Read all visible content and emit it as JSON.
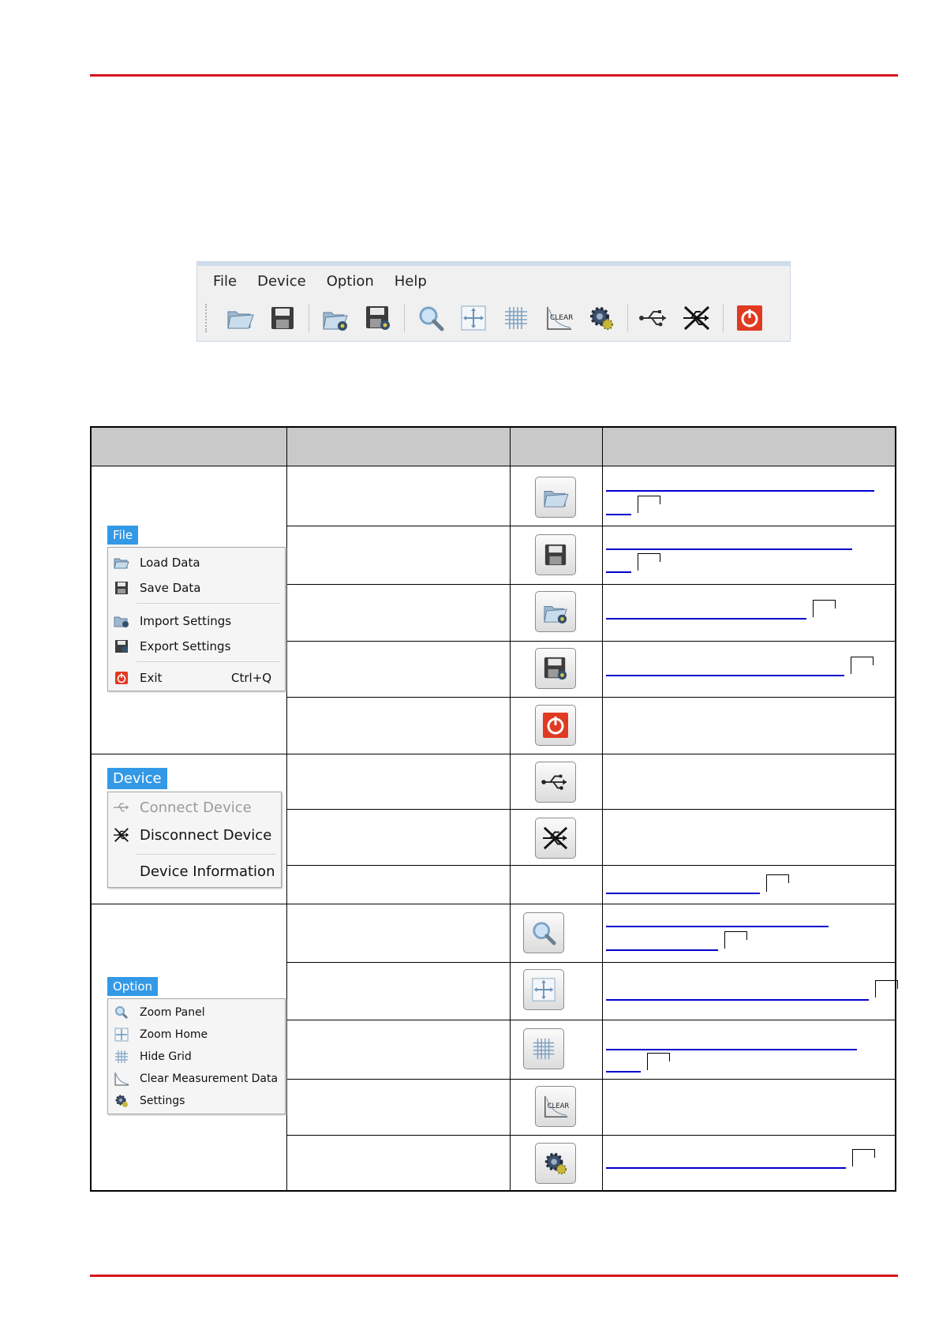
{
  "toolbar": {
    "menus": [
      "File",
      "Device",
      "Option",
      "Help"
    ]
  },
  "menus": {
    "file": {
      "title": "File",
      "items": [
        {
          "label": "Load Data",
          "shortcut": ""
        },
        {
          "label": "Save Data",
          "shortcut": ""
        },
        {
          "label": "Import Settings",
          "shortcut": ""
        },
        {
          "label": "Export Settings",
          "shortcut": ""
        },
        {
          "label": "Exit",
          "shortcut": "Ctrl+Q"
        }
      ]
    },
    "device": {
      "title": "Device",
      "items": [
        {
          "label": "Connect Device"
        },
        {
          "label": "Disconnect Device"
        },
        {
          "label": "Device Information"
        }
      ]
    },
    "option": {
      "title": "Option",
      "items": [
        {
          "label": "Zoom Panel"
        },
        {
          "label": "Zoom Home"
        },
        {
          "label": "Hide Grid"
        },
        {
          "label": "Clear Measurement Data"
        },
        {
          "label": "Settings"
        }
      ]
    }
  },
  "icons": {
    "open": "folder-icon",
    "save": "floppy-disk-icon",
    "import": "import-settings-icon",
    "export": "export-settings-icon",
    "zoom_panel": "magnifier-icon",
    "zoom_home": "zoom-home-icon",
    "grid": "grid-icon",
    "clear": "clear-chart-icon",
    "settings": "gear-icon",
    "connect": "usb-icon",
    "disconnect": "usb-disconnect-icon",
    "exit": "power-icon"
  },
  "colors": {
    "rule": "#d8141d",
    "header": "#c9c9c9",
    "link": "#0000cc",
    "menu_tab": "#3399e6",
    "exit_button": "#e03a22"
  }
}
